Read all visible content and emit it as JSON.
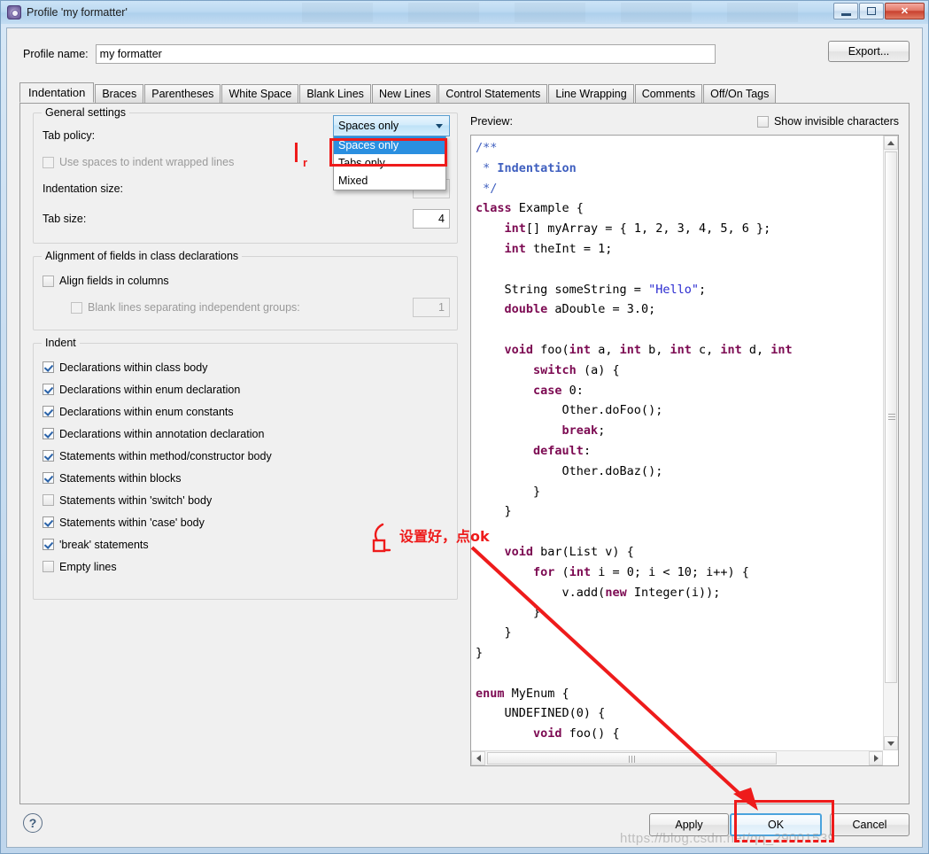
{
  "window": {
    "title": "Profile 'my formatter'",
    "icon": "eclipse-profile-icon",
    "minimize": "minimize-icon",
    "maximize": "maximize-icon",
    "close": "✕"
  },
  "profile": {
    "name_label": "Profile name:",
    "name_value": "my formatter",
    "export_label": "Export..."
  },
  "tabs": [
    {
      "label": "Indentation",
      "active": true
    },
    {
      "label": "Braces",
      "active": false
    },
    {
      "label": "Parentheses",
      "active": false
    },
    {
      "label": "White Space",
      "active": false
    },
    {
      "label": "Blank Lines",
      "active": false
    },
    {
      "label": "New Lines",
      "active": false
    },
    {
      "label": "Control Statements",
      "active": false
    },
    {
      "label": "Line Wrapping",
      "active": false
    },
    {
      "label": "Comments",
      "active": false
    },
    {
      "label": "Off/On Tags",
      "active": false
    }
  ],
  "general_settings": {
    "group_title": "General settings",
    "tab_policy_label": "Tab policy:",
    "tab_policy_value": "Spaces only",
    "tab_policy_options": [
      "Spaces only",
      "Tabs only",
      "Mixed"
    ],
    "use_spaces_label": "Use spaces to indent wrapped lines",
    "use_spaces_checked": false,
    "indentation_size_label": "Indentation size:",
    "indentation_size_value": "",
    "tab_size_label": "Tab size:",
    "tab_size_value": "4"
  },
  "alignment": {
    "group_title": "Alignment of fields in class declarations",
    "align_fields_label": "Align fields in columns",
    "align_fields_checked": false,
    "blank_lines_label": "Blank lines separating independent groups:",
    "blank_lines_checked": false,
    "blank_lines_value": "1"
  },
  "indent": {
    "group_title": "Indent",
    "items": [
      {
        "label": "Declarations within class body",
        "checked": true
      },
      {
        "label": "Declarations within enum declaration",
        "checked": true
      },
      {
        "label": "Declarations within enum constants",
        "checked": true
      },
      {
        "label": "Declarations within annotation declaration",
        "checked": true
      },
      {
        "label": "Statements within method/constructor body",
        "checked": true
      },
      {
        "label": "Statements within blocks",
        "checked": true
      },
      {
        "label": "Statements within 'switch' body",
        "checked": false
      },
      {
        "label": "Statements within 'case' body",
        "checked": true
      },
      {
        "label": "'break' statements",
        "checked": true
      },
      {
        "label": "Empty lines",
        "checked": false
      }
    ]
  },
  "preview": {
    "label": "Preview:",
    "show_invisible_label": "Show invisible characters",
    "show_invisible_checked": false,
    "code_lines": [
      "/**",
      " * Indentation",
      " */",
      "class Example {",
      "    int[] myArray = { 1, 2, 3, 4, 5, 6 };",
      "    int theInt = 1;",
      "",
      "    String someString = \"Hello\";",
      "    double aDouble = 3.0;",
      "",
      "    void foo(int a, int b, int c, int d, int",
      "        switch (a) {",
      "        case 0:",
      "            Other.doFoo();",
      "            break;",
      "        default:",
      "            Other.doBaz();",
      "        }",
      "    }",
      "",
      "    void bar(List v) {",
      "        for (int i = 0; i < 10; i++) {",
      "            v.add(new Integer(i));",
      "        }",
      "    }",
      "}",
      "",
      "enum MyEnum {",
      "    UNDEFINED(0) {",
      "        void foo() {"
    ]
  },
  "bottom": {
    "help_icon": "?",
    "apply_label": "Apply",
    "ok_label": "OK",
    "cancel_label": "Cancel"
  },
  "annotations": {
    "instruction_text": "设置好，点ok",
    "marker_letter": "r",
    "watermark": "https://blog.csdn.net/qq_29001539",
    "highlight_color": "#ee1b1b"
  }
}
